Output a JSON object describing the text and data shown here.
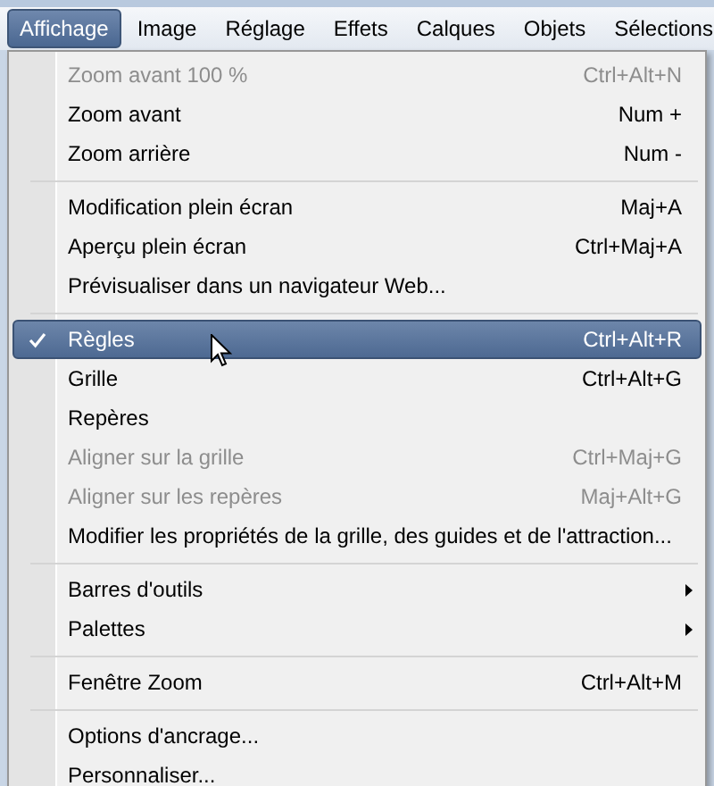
{
  "menubar": [
    {
      "label": "Affichage",
      "selected": true
    },
    {
      "label": "Image",
      "selected": false
    },
    {
      "label": "Réglage",
      "selected": false
    },
    {
      "label": "Effets",
      "selected": false
    },
    {
      "label": "Calques",
      "selected": false
    },
    {
      "label": "Objets",
      "selected": false
    },
    {
      "label": "Sélections",
      "selected": false
    }
  ],
  "menu": {
    "items": [
      {
        "kind": "item",
        "label": "Zoom avant 100 %",
        "shortcut": "Ctrl+Alt+N",
        "disabled": true,
        "checked": false,
        "selected": false
      },
      {
        "kind": "item",
        "label": "Zoom avant",
        "shortcut": "Num +",
        "disabled": false,
        "checked": false,
        "selected": false
      },
      {
        "kind": "item",
        "label": "Zoom arrière",
        "shortcut": "Num -",
        "disabled": false,
        "checked": false,
        "selected": false
      },
      {
        "kind": "separator"
      },
      {
        "kind": "item",
        "label": "Modification plein écran",
        "shortcut": "Maj+A",
        "disabled": false,
        "checked": false,
        "selected": false
      },
      {
        "kind": "item",
        "label": "Aperçu plein écran",
        "shortcut": "Ctrl+Maj+A",
        "disabled": false,
        "checked": false,
        "selected": false
      },
      {
        "kind": "item",
        "label": "Prévisualiser dans un navigateur Web...",
        "disabled": false,
        "checked": false,
        "selected": false
      },
      {
        "kind": "separator"
      },
      {
        "kind": "item",
        "label": "Règles",
        "shortcut": "Ctrl+Alt+R",
        "disabled": false,
        "checked": true,
        "selected": true
      },
      {
        "kind": "item",
        "label": "Grille",
        "shortcut": "Ctrl+Alt+G",
        "disabled": false,
        "checked": false,
        "selected": false
      },
      {
        "kind": "item",
        "label": "Repères",
        "disabled": false,
        "checked": false,
        "selected": false
      },
      {
        "kind": "item",
        "label": "Aligner sur la grille",
        "shortcut": "Ctrl+Maj+G",
        "disabled": true,
        "checked": false,
        "selected": false
      },
      {
        "kind": "item",
        "label": "Aligner sur les repères",
        "shortcut": "Maj+Alt+G",
        "disabled": true,
        "checked": false,
        "selected": false
      },
      {
        "kind": "item",
        "label": "Modifier les propriétés de la grille, des guides et de l'attraction...",
        "disabled": false,
        "checked": false,
        "selected": false
      },
      {
        "kind": "separator"
      },
      {
        "kind": "submenu",
        "label": "Barres d'outils",
        "disabled": false,
        "checked": false,
        "selected": false
      },
      {
        "kind": "submenu",
        "label": "Palettes",
        "disabled": false,
        "checked": false,
        "selected": false
      },
      {
        "kind": "separator"
      },
      {
        "kind": "item",
        "label": "Fenêtre Zoom",
        "shortcut": "Ctrl+Alt+M",
        "disabled": false,
        "checked": false,
        "selected": false
      },
      {
        "kind": "separator"
      },
      {
        "kind": "item",
        "label": "Options d'ancrage...",
        "disabled": false,
        "checked": false,
        "selected": false
      },
      {
        "kind": "item",
        "label": "Personnaliser...",
        "disabled": false,
        "checked": false,
        "selected": false
      }
    ]
  }
}
